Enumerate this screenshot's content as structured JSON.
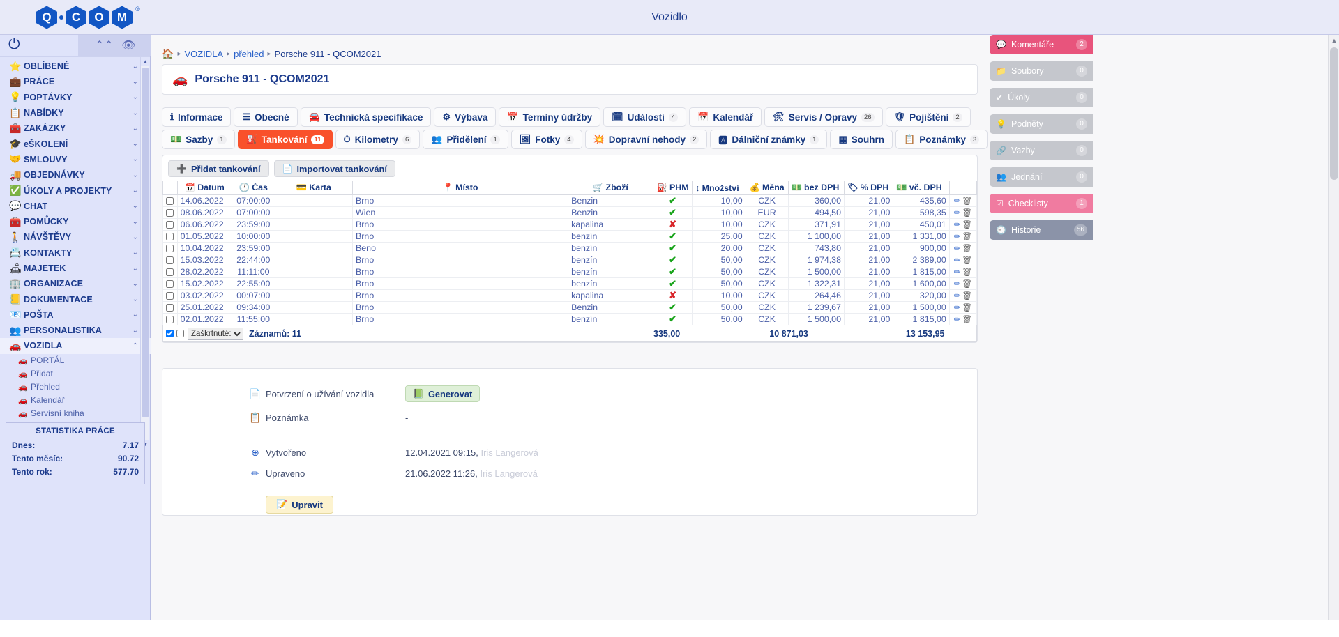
{
  "window": {
    "title": "Vozidlo"
  },
  "logo": {
    "letters": [
      "Q",
      "C",
      "O",
      "M"
    ],
    "registered": "®"
  },
  "sidebar": {
    "power_icon": "power-icon",
    "collapse_icon": "chevron-double-up-icon",
    "hide_icon": "eye-slash-icon",
    "items": [
      {
        "label": "OBLÍBENÉ",
        "icon": "⭐",
        "chev": "⌄"
      },
      {
        "label": "PRÁCE",
        "icon": "💼",
        "chev": "⌄"
      },
      {
        "label": "POPTÁVKY",
        "icon": "💡",
        "chev": "⌄"
      },
      {
        "label": "NABÍDKY",
        "icon": "📋",
        "chev": "⌄"
      },
      {
        "label": "ZAKÁZKY",
        "icon": "🧰",
        "chev": "⌄"
      },
      {
        "label": "eŠKOLENÍ",
        "icon": "🎓",
        "chev": "⌄"
      },
      {
        "label": "SMLOUVY",
        "icon": "🤝",
        "chev": "⌄"
      },
      {
        "label": "OBJEDNÁVKY",
        "icon": "🚚",
        "chev": "⌄"
      },
      {
        "label": "ÚKOLY A PROJEKTY",
        "icon": "✅",
        "chev": "⌄"
      },
      {
        "label": "CHAT",
        "icon": "💬",
        "chev": "⌄"
      },
      {
        "label": "POMŮCKY",
        "icon": "🧰",
        "chev": "⌄"
      },
      {
        "label": "NÁVŠTĚVY",
        "icon": "🚶",
        "chev": "⌄"
      },
      {
        "label": "KONTAKTY",
        "icon": "📇",
        "chev": "⌄"
      },
      {
        "label": "MAJETEK",
        "icon": "🛋",
        "chev": "⌄"
      },
      {
        "label": "ORGANIZACE",
        "icon": "🏢",
        "chev": "⌄"
      },
      {
        "label": "DOKUMENTACE",
        "icon": "📒",
        "chev": "⌄"
      },
      {
        "label": "POŠTA",
        "icon": "📧",
        "chev": "⌄"
      },
      {
        "label": "PERSONALISTIKA",
        "icon": "👥",
        "chev": "⌄"
      },
      {
        "label": "VOZIDLA",
        "icon": "🚗",
        "chev": "⌃",
        "active": true
      }
    ],
    "subitems": [
      {
        "label": "PORTÁL",
        "icon": "🚗"
      },
      {
        "label": "Přidat",
        "icon": "🚗"
      },
      {
        "label": "Přehled",
        "icon": "🚗"
      },
      {
        "label": "Kalendář",
        "icon": "🚗"
      },
      {
        "label": "Servisní kniha",
        "icon": "🚗"
      }
    ],
    "stats": {
      "title": "STATISTIKA PRÁCE",
      "rows": [
        {
          "label": "Dnes:",
          "value": "7.17"
        },
        {
          "label": "Tento měsíc:",
          "value": "90.72"
        },
        {
          "label": "Tento rok:",
          "value": "577.70"
        }
      ]
    }
  },
  "breadcrumb": {
    "home_icon": "home-icon",
    "items": [
      "VOZIDLA",
      "přehled",
      "Porsche 911 - QCOM2021"
    ]
  },
  "page": {
    "icon": "car-icon",
    "title": "Porsche 911 - QCOM2021"
  },
  "tabs": {
    "row1": [
      {
        "label": "Informace",
        "icon": "ℹ",
        "count": ""
      },
      {
        "label": "Obecné",
        "icon": "☰",
        "count": ""
      },
      {
        "label": "Technická specifikace",
        "icon": "🚘",
        "count": ""
      },
      {
        "label": "Výbava",
        "icon": "⚙",
        "count": ""
      },
      {
        "label": "Termíny údržby",
        "icon": "📅",
        "count": ""
      },
      {
        "label": "Události",
        "icon": "🗓",
        "count": "4"
      },
      {
        "label": "Kalendář",
        "icon": "📅",
        "count": ""
      },
      {
        "label": "Servis / Opravy",
        "icon": "🛠",
        "count": "26"
      },
      {
        "label": "Pojištění",
        "icon": "🛡",
        "count": "2"
      }
    ],
    "row2": [
      {
        "label": "Sazby",
        "icon": "💵",
        "count": "1"
      },
      {
        "label": "Tankování",
        "icon": "⛽",
        "count": "11",
        "active": true
      },
      {
        "label": "Kilometry",
        "icon": "⏱",
        "count": "6"
      },
      {
        "label": "Přidělení",
        "icon": "👥",
        "count": "1"
      },
      {
        "label": "Fotky",
        "icon": "🖼",
        "count": "4"
      },
      {
        "label": "Dopravní nehody",
        "icon": "💥",
        "count": "2"
      },
      {
        "label": "Dálniční známky",
        "icon": "🅰",
        "count": "1"
      },
      {
        "label": "Souhrn",
        "icon": "▦",
        "count": ""
      },
      {
        "label": "Poznámky",
        "icon": "📋",
        "count": "3"
      }
    ]
  },
  "toolbar": {
    "add_label": "Přidat tankování",
    "add_icon": "plus-circle-icon",
    "import_label": "Importovat tankování",
    "import_icon": "file-import-icon"
  },
  "table": {
    "headers": [
      {
        "label": "",
        "icon": ""
      },
      {
        "label": "Datum",
        "icon": "📅"
      },
      {
        "label": "Čas",
        "icon": "🕐"
      },
      {
        "label": "Karta",
        "icon": "💳"
      },
      {
        "label": "Místo",
        "icon": "📍"
      },
      {
        "label": "Zboží",
        "icon": "🛒"
      },
      {
        "label": "PHM",
        "icon": "⛽"
      },
      {
        "label": "Množství",
        "icon": "↕"
      },
      {
        "label": "Měna",
        "icon": "💰"
      },
      {
        "label": "bez DPH",
        "icon": "💵"
      },
      {
        "label": "% DPH",
        "icon": "🏷"
      },
      {
        "label": "vč. DPH",
        "icon": "💵"
      },
      {
        "label": "",
        "icon": ""
      }
    ],
    "rows": [
      {
        "date": "14.06.2022",
        "time": "07:00:00",
        "card": "",
        "place": "Brno",
        "goods": "Benzin",
        "phm": true,
        "qty": "10,00",
        "currency": "CZK",
        "net": "360,00",
        "vat": "21,00",
        "gross": "435,60"
      },
      {
        "date": "08.06.2022",
        "time": "07:00:00",
        "card": "",
        "place": "Wien",
        "goods": "Benzin",
        "phm": true,
        "qty": "10,00",
        "currency": "EUR",
        "net": "494,50",
        "vat": "21,00",
        "gross": "598,35"
      },
      {
        "date": "06.06.2022",
        "time": "23:59:00",
        "card": "",
        "place": "Brno",
        "goods": "kapalina",
        "phm": false,
        "qty": "10,00",
        "currency": "CZK",
        "net": "371,91",
        "vat": "21,00",
        "gross": "450,01"
      },
      {
        "date": "01.05.2022",
        "time": "10:00:00",
        "card": "",
        "place": "Brno",
        "goods": "benzín",
        "phm": true,
        "qty": "25,00",
        "currency": "CZK",
        "net": "1 100,00",
        "vat": "21,00",
        "gross": "1 331,00"
      },
      {
        "date": "10.04.2022",
        "time": "23:59:00",
        "card": "",
        "place": "Beno",
        "goods": "benzín",
        "phm": true,
        "qty": "20,00",
        "currency": "CZK",
        "net": "743,80",
        "vat": "21,00",
        "gross": "900,00"
      },
      {
        "date": "15.03.2022",
        "time": "22:44:00",
        "card": "",
        "place": "Brno",
        "goods": "benzín",
        "phm": true,
        "qty": "50,00",
        "currency": "CZK",
        "net": "1 974,38",
        "vat": "21,00",
        "gross": "2 389,00"
      },
      {
        "date": "28.02.2022",
        "time": "11:11:00",
        "card": "",
        "place": "Brno",
        "goods": "benzín",
        "phm": true,
        "qty": "50,00",
        "currency": "CZK",
        "net": "1 500,00",
        "vat": "21,00",
        "gross": "1 815,00"
      },
      {
        "date": "15.02.2022",
        "time": "22:55:00",
        "card": "",
        "place": "Brno",
        "goods": "benzín",
        "phm": true,
        "qty": "50,00",
        "currency": "CZK",
        "net": "1 322,31",
        "vat": "21,00",
        "gross": "1 600,00"
      },
      {
        "date": "03.02.2022",
        "time": "00:07:00",
        "card": "",
        "place": "Brno",
        "goods": "kapalina",
        "phm": false,
        "qty": "10,00",
        "currency": "CZK",
        "net": "264,46",
        "vat": "21,00",
        "gross": "320,00"
      },
      {
        "date": "25.01.2022",
        "time": "09:34:00",
        "card": "",
        "place": "Brno",
        "goods": "Benzin",
        "phm": true,
        "qty": "50,00",
        "currency": "CZK",
        "net": "1 239,67",
        "vat": "21,00",
        "gross": "1 500,00"
      },
      {
        "date": "02.01.2022",
        "time": "11:55:00",
        "card": "",
        "place": "Brno",
        "goods": "benzín",
        "phm": true,
        "qty": "50,00",
        "currency": "CZK",
        "net": "1 500,00",
        "vat": "21,00",
        "gross": "1 815,00"
      }
    ],
    "footer": {
      "select_value": "Zaškrtnuté:",
      "record_label": "Záznamů: 11",
      "total_qty": "335,00",
      "total_net": "10 871,03",
      "total_gross": "13 153,95"
    }
  },
  "info": {
    "confirm_label": "Potvrzení o užívání vozidla",
    "confirm_icon": "pdf-icon",
    "generate_label": "Generovat",
    "generate_icon": "file-excel-icon",
    "note_label": "Poznámka",
    "note_icon": "clipboard-icon",
    "note_value": "-",
    "created_label": "Vytvořeno",
    "created_icon": "plus-circle-icon",
    "created_value": "12.04.2021 09:15,",
    "created_user": "Iris Langerová",
    "updated_label": "Upraveno",
    "updated_icon": "pencil-icon",
    "updated_value": "21.06.2022 11:26,",
    "updated_user": "Iris Langerová",
    "edit_label": "Upravit",
    "edit_icon": "edit-icon"
  },
  "right_panel": {
    "buttons": [
      {
        "label": "Komentáře",
        "icon": "💬",
        "count": "2",
        "color": "#e8547c"
      },
      {
        "label": "Soubory",
        "icon": "📁",
        "count": "0",
        "color": "#c5c7cd"
      },
      {
        "label": "Úkoly",
        "icon": "✔",
        "count": "0",
        "color": "#c5c7cd"
      },
      {
        "label": "Podněty",
        "icon": "💡",
        "count": "0",
        "color": "#c5c7cd"
      },
      {
        "label": "Vazby",
        "icon": "🔗",
        "count": "0",
        "color": "#c5c7cd"
      },
      {
        "label": "Jednání",
        "icon": "👥",
        "count": "0",
        "color": "#c5c7cd"
      },
      {
        "label": "Checklisty",
        "icon": "☑",
        "count": "1",
        "color": "#f07ba0"
      },
      {
        "label": "Historie",
        "icon": "🕘",
        "count": "56",
        "color": "#8b93a8"
      }
    ]
  }
}
